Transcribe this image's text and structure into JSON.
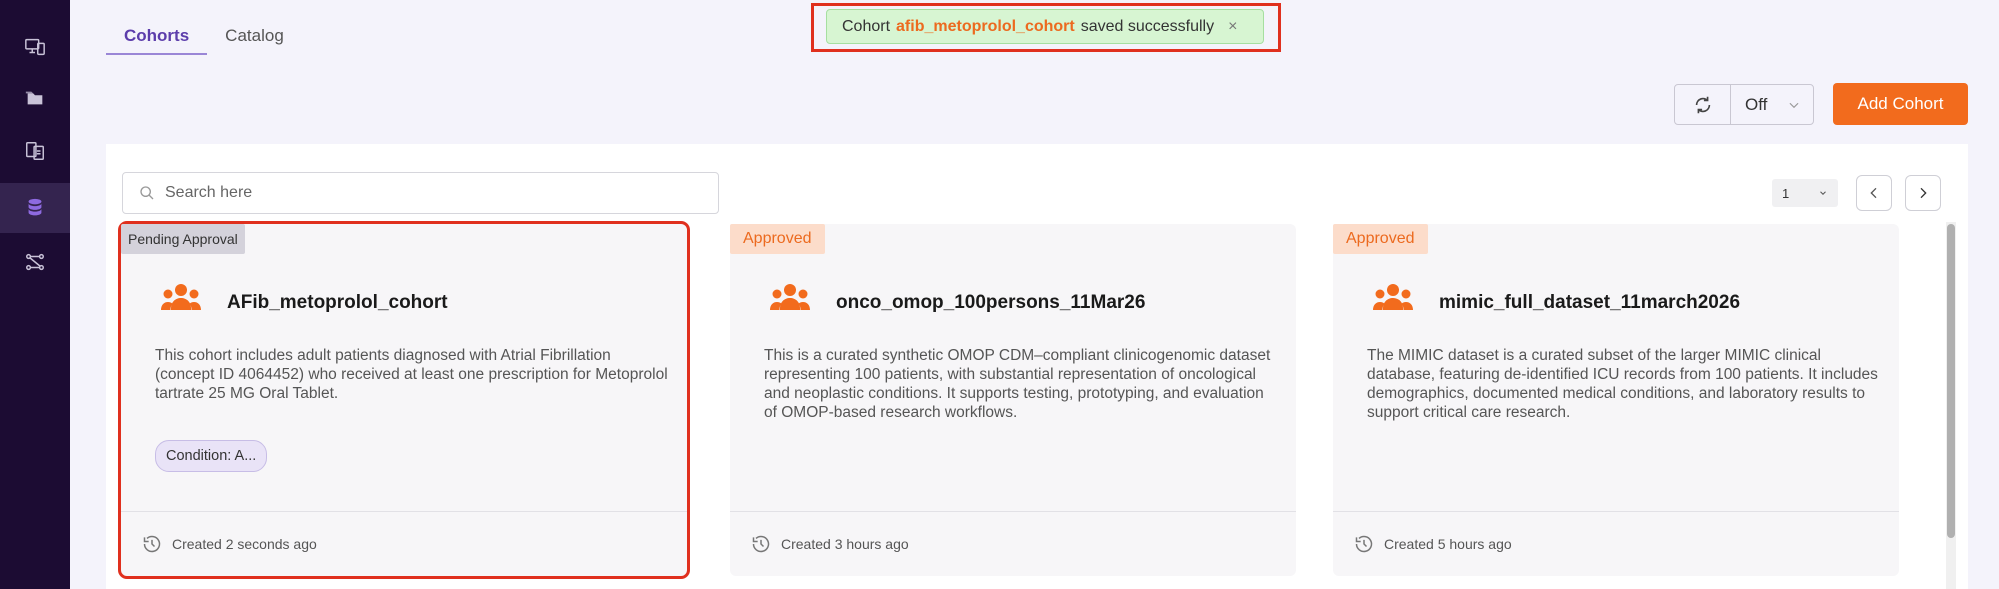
{
  "sidebar": {
    "items": [
      {
        "icon": "monitor-devices-icon",
        "active": false
      },
      {
        "icon": "folders-icon",
        "active": false
      },
      {
        "icon": "document-export-icon",
        "active": false
      },
      {
        "icon": "database-icon",
        "active": true
      },
      {
        "icon": "workflow-icon",
        "active": false
      }
    ]
  },
  "tabs": [
    {
      "label": "Cohorts",
      "active": true
    },
    {
      "label": "Catalog",
      "active": false
    }
  ],
  "toast": {
    "prefix": "Cohort",
    "cohort_name": "afib_metoprolol_cohort",
    "suffix": "saved successfully",
    "close_symbol": "×"
  },
  "controls": {
    "refresh_interval": "Off",
    "add_cohort_label": "Add Cohort"
  },
  "search": {
    "placeholder": "Search here",
    "value": ""
  },
  "pagination": {
    "page": "1"
  },
  "cards": [
    {
      "status": "Pending Approval",
      "title": "AFib_metoprolol_cohort",
      "description": "This cohort includes adult patients diagnosed with Atrial Fibrillation (concept ID 4064452) who received at least one prescription for Metoprolol tartrate 25 MG Oral Tablet.",
      "tag": "Condition: A...",
      "created": "Created 2 seconds ago"
    },
    {
      "status": "Approved",
      "title": "onco_omop_100persons_11Mar26",
      "description": "This is a curated synthetic OMOP CDM–compliant clinicogenomic dataset representing 100 patients, with substantial representation of oncological and neoplastic conditions. It supports testing, prototyping, and evaluation of OMOP-based research workflows.",
      "created": "Created 3 hours ago"
    },
    {
      "status": "Approved",
      "title": "mimic_full_dataset_11march2026",
      "description": "The MIMIC dataset is a curated subset of the larger MIMIC clinical database, featuring de-identified ICU records from 100 patients. It includes demographics, documented medical conditions, and laboratory results to support critical care research.",
      "created": "Created 5 hours ago"
    }
  ],
  "colors": {
    "sidebar_bg": "#1c0c33",
    "accent_orange": "#f26b1d",
    "tab_active": "#5c3dab",
    "toast_bg": "#d7f5d2",
    "highlight_frame": "#e0301e"
  }
}
